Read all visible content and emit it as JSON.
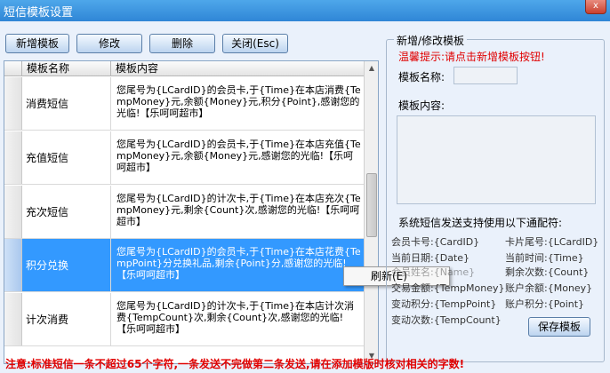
{
  "window": {
    "title": "短信模板设置",
    "close_glyph": "x"
  },
  "toolbar": {
    "add_label": "新增模板",
    "edit_label": "修改",
    "delete_label": "删除",
    "close_label": "关闭(Esc)"
  },
  "grid": {
    "col_name": "模板名称",
    "col_content": "模板内容",
    "rows": [
      {
        "name": "消费短信",
        "content": "您尾号为{LCardID}的会员卡,于{Time}在本店消费{TempMoney}元,余额{Money}元,积分{Point},感谢您的光临!【乐呵呵超市】"
      },
      {
        "name": "充值短信",
        "content": "您尾号为{LCardID}的会员卡,于{Time}在本店充值{TempMoney}元,余额{Money}元,感谢您的光临!【乐呵呵超市】"
      },
      {
        "name": "充次短信",
        "content": "您尾号为{LCardID}的计次卡,于{Time}在本店充次{TempMoney}元,剩余{Count}次,感谢您的光临!【乐呵呵超市】"
      },
      {
        "name": "积分兑换",
        "content": "您尾号为{LCardID}的会员卡,于{Time}在本店花费{TempPoint}分兑换礼品,剩余{Point}分,感谢您的光临!【乐呵呵超市】"
      },
      {
        "name": "计次消费",
        "content": "您尾号为{LCardID}的计次卡,于{Time}在本店计次消费{TempCount}次,剩余{Count}次,感谢您的光临!【乐呵呵超市】"
      }
    ],
    "selected_index": 3
  },
  "context_menu": {
    "refresh_label": "刷新(E)"
  },
  "form": {
    "group_title": "新增/修改模板",
    "hint": "温馨提示:请点击新增模板按钮!",
    "name_label": "模板名称:",
    "content_label": "模板内容:",
    "wildcards_title": "系统短信发送支持使用以下通配符:",
    "wildcards": [
      {
        "label": "会员卡号:",
        "value": "{CardID}"
      },
      {
        "label": "卡片尾号:",
        "value": "{LCardID}"
      },
      {
        "label": "当前日期:",
        "value": "{Date}"
      },
      {
        "label": "当前时间:",
        "value": "{Time}"
      },
      {
        "label": "会员姓名:",
        "value": "{Name}"
      },
      {
        "label": "剩余次数:",
        "value": "{Count}"
      },
      {
        "label": "交易金额:",
        "value": "{TempMoney}"
      },
      {
        "label": "账户余额:",
        "value": "{Money}"
      },
      {
        "label": "变动积分:",
        "value": "{TempPoint}"
      },
      {
        "label": "账户积分:",
        "value": "{Point}"
      },
      {
        "label": "变动次数:",
        "value": "{TempCount}"
      }
    ],
    "save_label": "保存模板"
  },
  "footer": {
    "warning": "注意:标准短信一条不超过65个字符,一条发送不完做第二条发送,请在添加模版时核对相关的字数!"
  }
}
